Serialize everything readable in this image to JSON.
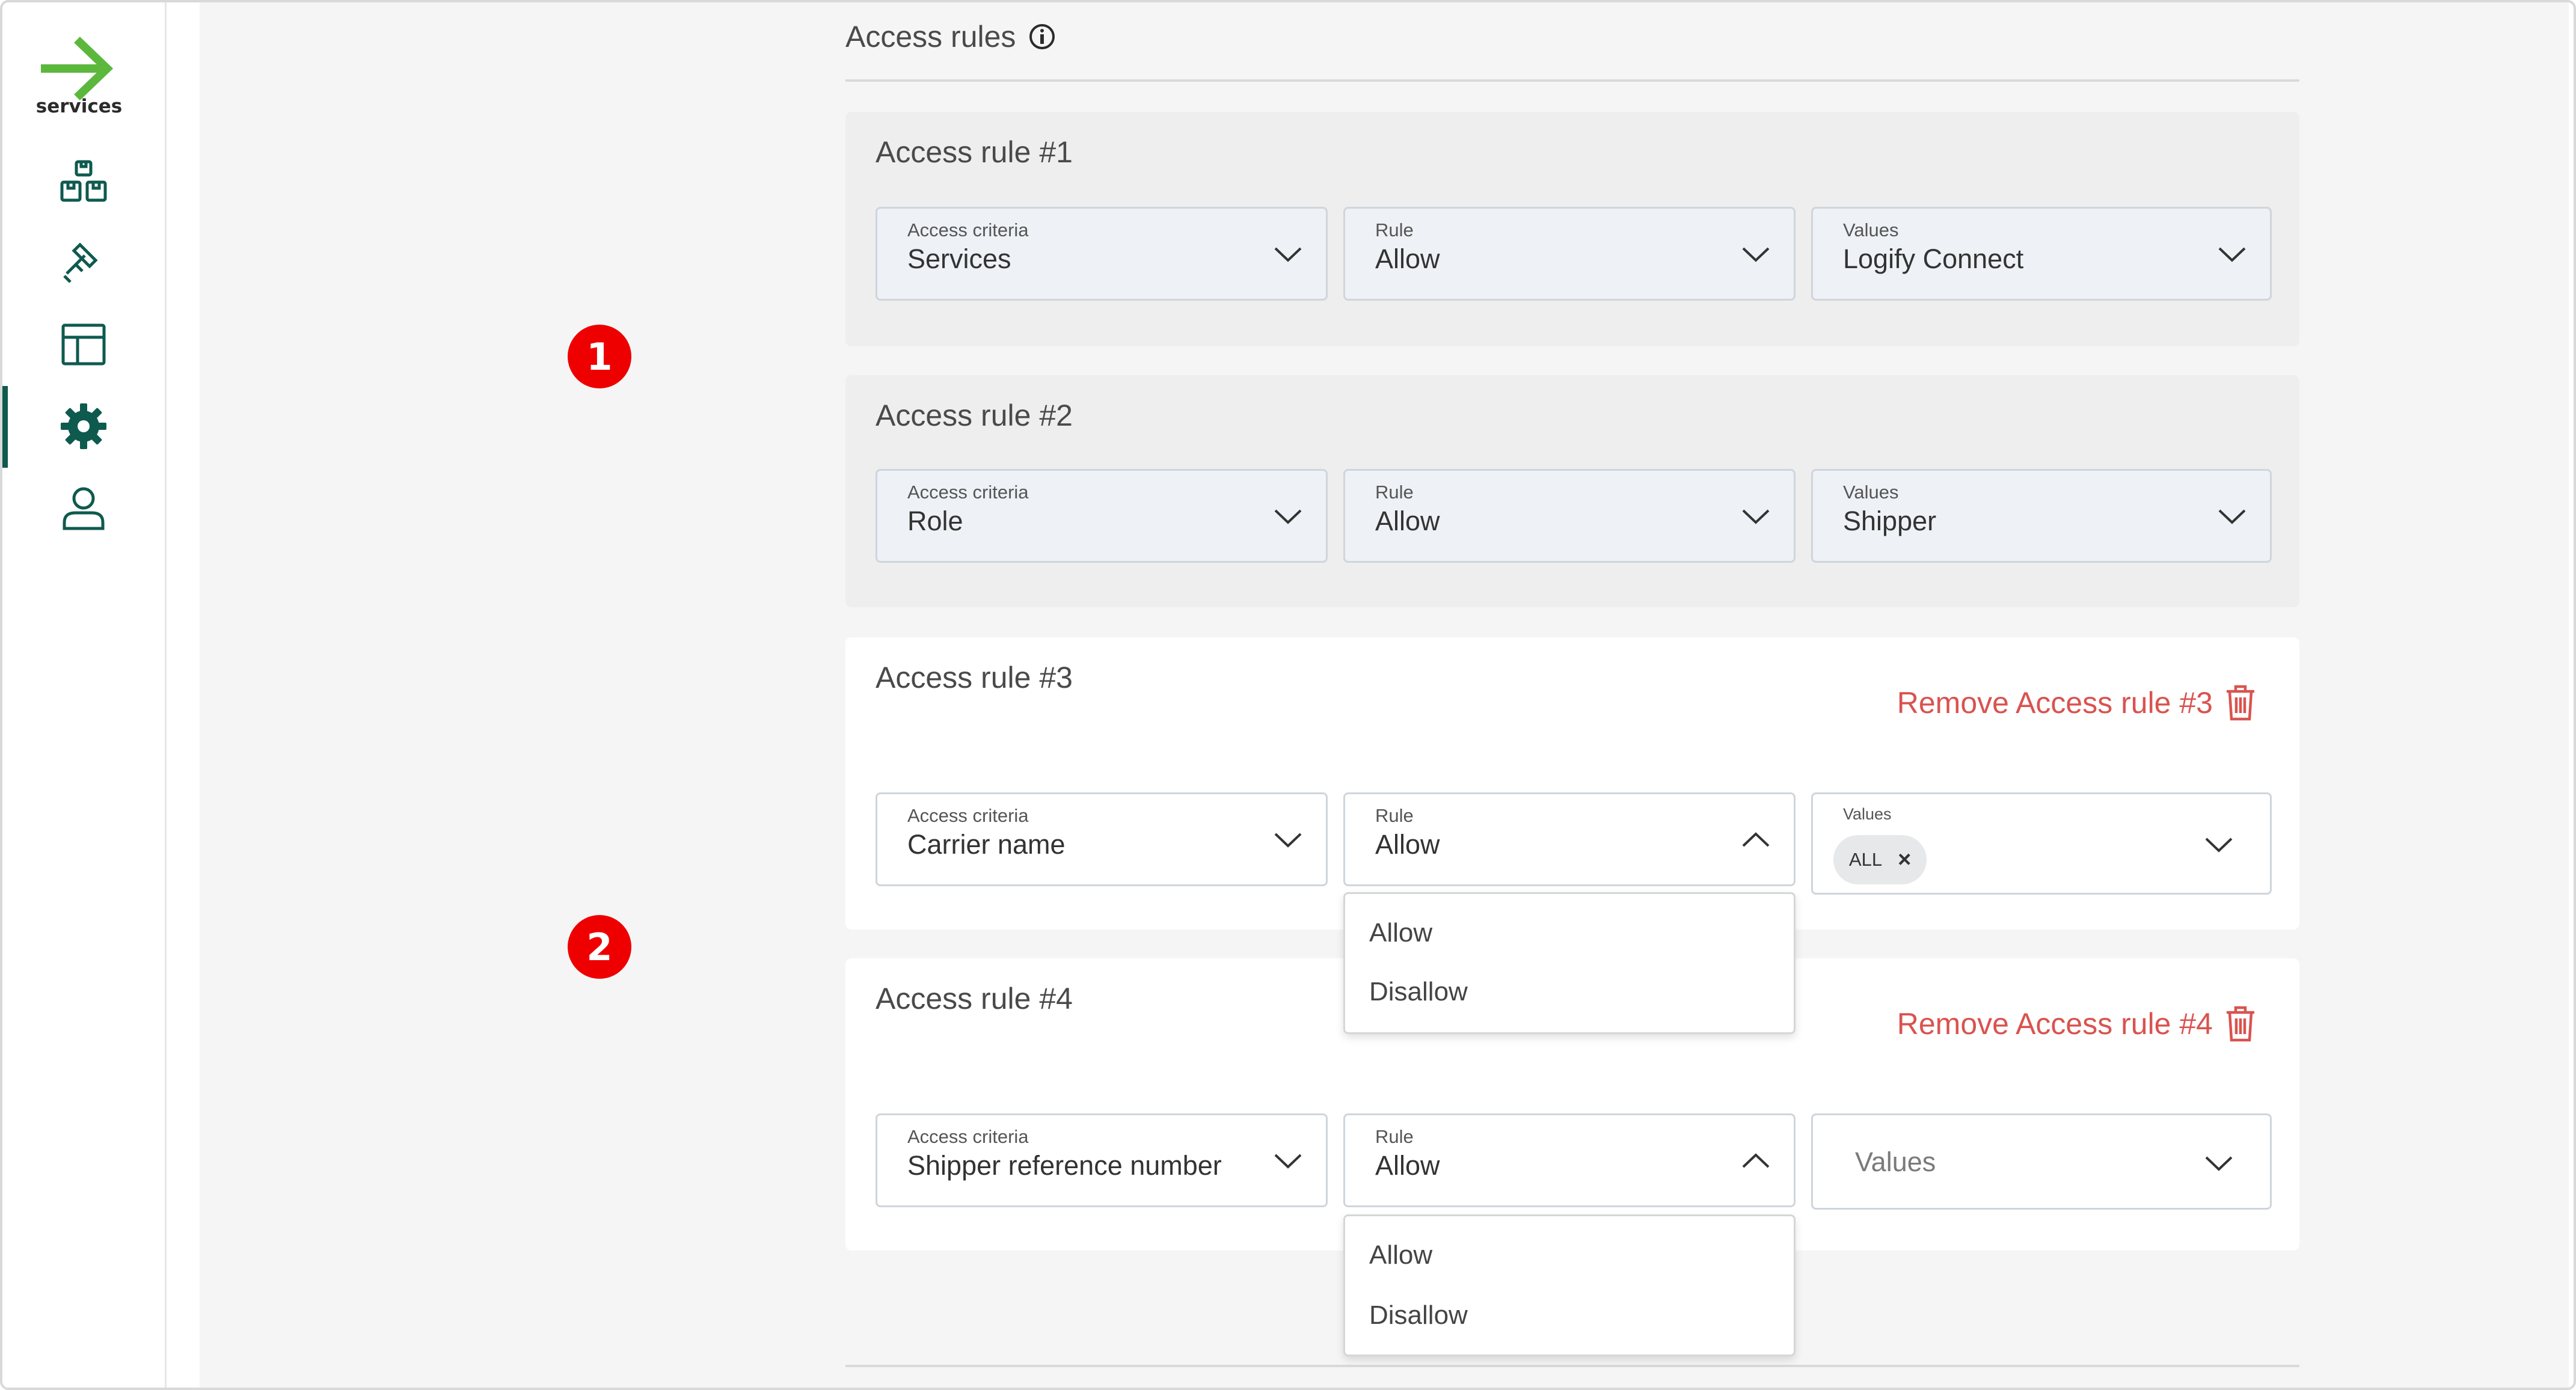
{
  "sidebar": {
    "brand": "services",
    "items": [
      {
        "icon": "boxes-icon"
      },
      {
        "icon": "gavel-icon"
      },
      {
        "icon": "layout-icon"
      },
      {
        "icon": "gear-icon",
        "active": true
      },
      {
        "icon": "user-icon"
      }
    ]
  },
  "section": {
    "title": "Access rules"
  },
  "labels": {
    "criteria": "Access criteria",
    "rule": "Rule",
    "values": "Values"
  },
  "rules": [
    {
      "title": "Access rule #1",
      "criteria": "Services",
      "rule": "Allow",
      "values": "Logify Connect"
    },
    {
      "title": "Access rule #2",
      "criteria": "Role",
      "rule": "Allow",
      "values": "Shipper"
    },
    {
      "title": "Access rule #3",
      "remove": "Remove Access rule #3",
      "criteria": "Carrier name",
      "rule": "Allow",
      "chip": "ALL",
      "chip_remove": "×"
    },
    {
      "title": "Access rule #4",
      "remove": "Remove Access rule #4",
      "criteria": "Shipper reference number",
      "rule": "Allow",
      "values_placeholder": "Values"
    }
  ],
  "dropdown_options": [
    "Allow",
    "Disallow"
  ],
  "badges": [
    "1",
    "2"
  ],
  "colors": {
    "brand_green": "#5cb83c",
    "sidebar_icon": "#0e5a4e",
    "remove_red": "#d9534f",
    "badge_red": "#ee0000"
  }
}
